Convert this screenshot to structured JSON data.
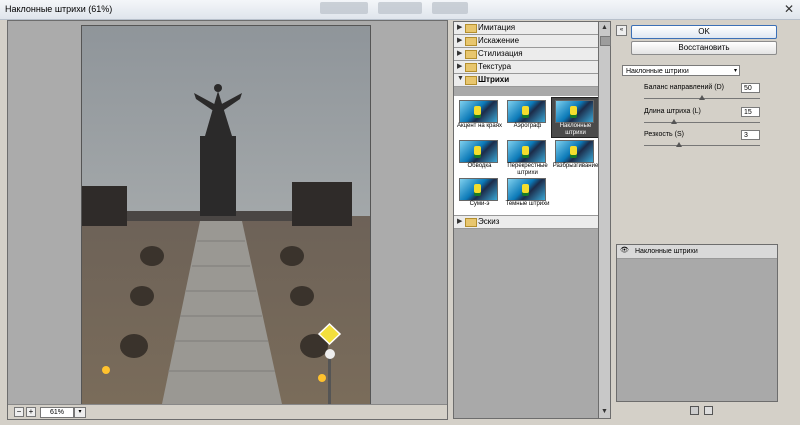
{
  "window": {
    "title": "Наклонные штрихи (61%)",
    "close_glyph": "✕"
  },
  "preview": {
    "zoom_value": "61%",
    "zoom_out": "−",
    "zoom_in": "+",
    "zoom_dropdown": "▾"
  },
  "filter_gallery": {
    "categories_top": [
      {
        "label": "Имитация",
        "arrow": "▶"
      },
      {
        "label": "Искажение",
        "arrow": "▶"
      },
      {
        "label": "Стилизация",
        "arrow": "▶"
      },
      {
        "label": "Текстура",
        "arrow": "▶"
      }
    ],
    "open_category": {
      "label": "Штрихи",
      "arrow": "▼"
    },
    "thumbnails": [
      {
        "name": "Акцент на краях",
        "selected": false
      },
      {
        "name": "Аэрограф",
        "selected": false
      },
      {
        "name": "Наклонные штрихи",
        "selected": true
      },
      {
        "name": "Обводка",
        "selected": false
      },
      {
        "name": "Перекрестные штрихи",
        "selected": false
      },
      {
        "name": "Разбрызгивание",
        "selected": false
      },
      {
        "name": "Суми-э",
        "selected": false
      },
      {
        "name": "Темные штрихи",
        "selected": false
      }
    ],
    "categories_bottom": [
      {
        "label": "Эскиз",
        "arrow": "▶"
      }
    ],
    "scroll_up": "▲",
    "scroll_down": "▼"
  },
  "controls": {
    "ok_label": "OK",
    "reset_label": "Восстановить",
    "collapse_glyph": "«",
    "filter_select": "Наклонные штрихи",
    "select_arrow": "▾",
    "params": [
      {
        "label": "Баланс направлений (D)",
        "value": "50",
        "slider_fraction": 0.5
      },
      {
        "label": "Длина штриха (L)",
        "value": "15",
        "slider_fraction": 0.3
      },
      {
        "label": "Резкость (S)",
        "value": "3",
        "slider_fraction": 0.3
      }
    ]
  },
  "layers": {
    "eye_glyph": "👁",
    "items": [
      {
        "name": "Наклонные штрихи"
      }
    ]
  },
  "colors": {
    "accent": "#3b6fb6",
    "panel": "#a9a9a9",
    "selected_thumb": "#4a4a4a"
  }
}
